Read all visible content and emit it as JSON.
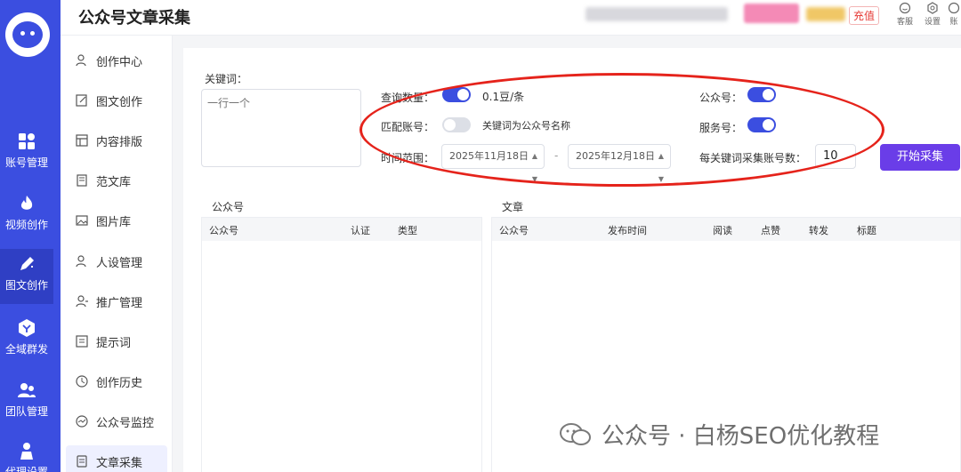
{
  "app": {
    "title": "公众号文章采集"
  },
  "header": {
    "recharge_label": "充值",
    "icons": [
      {
        "icon": "customer-service-icon",
        "label": "客服"
      },
      {
        "icon": "gear-icon",
        "label": "设置"
      },
      {
        "icon": "account-icon",
        "label": "账"
      }
    ]
  },
  "rail": {
    "items": [
      {
        "label": "账号管理",
        "icon": "grid-icon"
      },
      {
        "label": "视频创作",
        "icon": "flame-icon"
      },
      {
        "label": "图文创作",
        "icon": "pen-icon"
      },
      {
        "label": "全域群发",
        "icon": "hexagon-icon"
      },
      {
        "label": "团队管理",
        "icon": "team-icon"
      },
      {
        "label": "代理设置",
        "icon": "person-icon"
      }
    ]
  },
  "submenu": {
    "items": [
      {
        "label": "创作中心",
        "icon": "user-icon"
      },
      {
        "label": "图文创作",
        "icon": "edit-icon"
      },
      {
        "label": "内容排版",
        "icon": "layout-icon"
      },
      {
        "label": "范文库",
        "icon": "library-icon"
      },
      {
        "label": "图片库",
        "icon": "image-icon"
      },
      {
        "label": "人设管理",
        "icon": "persona-icon"
      },
      {
        "label": "推广管理",
        "icon": "promotion-icon"
      },
      {
        "label": "提示词",
        "icon": "prompt-icon"
      },
      {
        "label": "创作历史",
        "icon": "clock-icon"
      },
      {
        "label": "公众号监控",
        "icon": "monitor-icon"
      },
      {
        "label": "文章采集",
        "icon": "document-icon"
      }
    ]
  },
  "form": {
    "keyword_label": "关键词：",
    "keyword_placeholder": "一行一个",
    "query_quantity_label": "查询数量：",
    "query_quantity_price": "0.1豆/条",
    "match_account_label": "匹配账号：",
    "match_account_hint": "关键词为公众号名称",
    "time_range_label": "时间范围：",
    "date_start": "2025年11月18日",
    "date_end": "2025年12月18日",
    "date_separator": "-",
    "gzh_label": "公众号：",
    "service_label": "服务号：",
    "per_keyword_label": "每关键词采集账号数：",
    "per_keyword_value": "10",
    "start_button": "开始采集"
  },
  "toggles": {
    "query_quantity": true,
    "match_account": false,
    "gzh": true,
    "service": true
  },
  "accounts_table": {
    "title": "公众号",
    "columns": [
      "公众号",
      "认证",
      "类型"
    ],
    "rows": []
  },
  "articles_table": {
    "title": "文章",
    "columns": [
      "公众号",
      "发布时间",
      "阅读",
      "点赞",
      "转发",
      "标题"
    ],
    "rows": []
  },
  "watermark": "公众号 · 白杨SEO优化教程",
  "colors": {
    "primary": "#3b4ee0",
    "button": "#6a3de8",
    "annotation": "#e5231b"
  }
}
